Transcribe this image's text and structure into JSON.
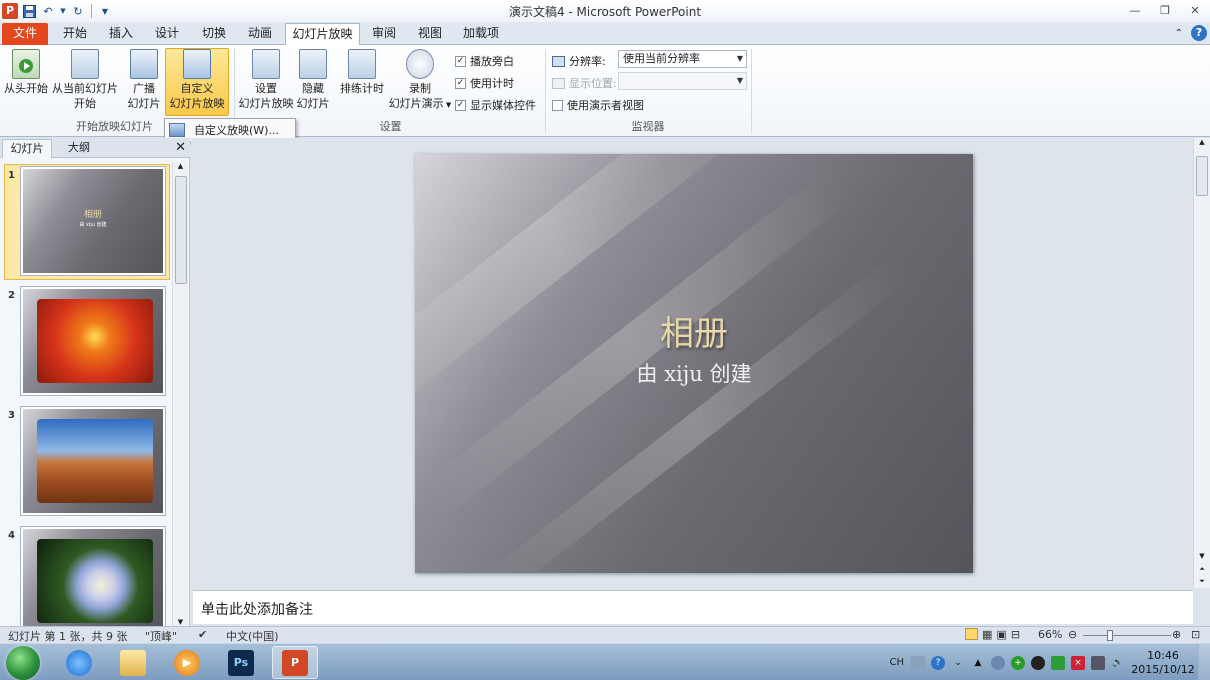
{
  "window": {
    "title": "演示文稿4 - Microsoft PowerPoint",
    "app_letter": "P"
  },
  "tabs": [
    {
      "label": "文件"
    },
    {
      "label": "开始"
    },
    {
      "label": "插入"
    },
    {
      "label": "设计"
    },
    {
      "label": "切换"
    },
    {
      "label": "动画"
    },
    {
      "label": "幻灯片放映"
    },
    {
      "label": "审阅"
    },
    {
      "label": "视图"
    },
    {
      "label": "加载项"
    }
  ],
  "ribbon": {
    "from_beginning": "从头开始",
    "from_current_1": "从当前幻灯片",
    "from_current_2": "开始",
    "broadcast_1": "广播",
    "broadcast_2": "幻灯片",
    "custom_1": "自定义",
    "custom_2": "幻灯片放映",
    "setup_1": "设置",
    "setup_2": "幻灯片放映",
    "hide_1": "隐藏",
    "hide_2": "幻灯片",
    "rehearse": "排练计时",
    "record_1": "录制",
    "record_2": "幻灯片演示",
    "group_start": "开始放映幻灯片",
    "group_setup": "设置",
    "group_monitors": "监视器",
    "play_narration": "播放旁白",
    "use_timings": "使用计时",
    "show_media": "显示媒体控件",
    "resolution_label": "分辨率:",
    "resolution_value": "使用当前分辨率",
    "show_on_label": "显示位置:",
    "presenter_view": "使用演示者视图"
  },
  "popup": {
    "custom_shows": "自定义放映(W)..."
  },
  "left_pane": {
    "tab_slides": "幻灯片",
    "tab_outline": "大纲",
    "thumbs": [
      {
        "num": "1",
        "title": "相册",
        "sub": "由 xiju 创建"
      },
      {
        "num": "2"
      },
      {
        "num": "3"
      },
      {
        "num": "4"
      }
    ]
  },
  "slide": {
    "title": "相册",
    "subtitle": "由 xiju 创建"
  },
  "notes": {
    "placeholder": "单击此处添加备注"
  },
  "status": {
    "slide_info": "幻灯片 第 1 张，共 9 张",
    "theme": "\"顶峰\"",
    "language": "中文(中国)",
    "zoom": "66%"
  },
  "taskbar": {
    "ime": "CH",
    "time": "10:46",
    "date": "2015/10/12"
  }
}
